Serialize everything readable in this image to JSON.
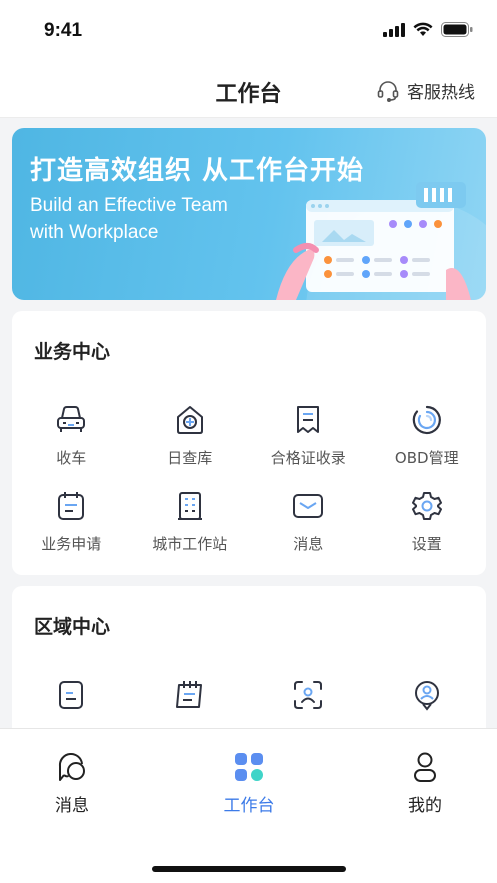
{
  "status_bar": {
    "time": "9:41"
  },
  "nav": {
    "title": "工作台",
    "service_label": "客服热线"
  },
  "banner": {
    "title": "打造高效组织 从工作台开始",
    "subtitle_line1": "Build an Effective Team",
    "subtitle_line2": "with Workplace"
  },
  "business_center": {
    "title": "业务中心",
    "items": [
      {
        "label": "收车",
        "icon": "car-icon"
      },
      {
        "label": "日查库",
        "icon": "warehouse-icon"
      },
      {
        "label": "合格证收录",
        "icon": "certificate-icon"
      },
      {
        "label": "OBD管理",
        "icon": "obd-gauge-icon"
      },
      {
        "label": "业务申请",
        "icon": "calendar-apply-icon"
      },
      {
        "label": "城市工作站",
        "icon": "building-icon"
      },
      {
        "label": "消息",
        "icon": "envelope-icon"
      },
      {
        "label": "设置",
        "icon": "gear-icon"
      }
    ]
  },
  "region_center": {
    "title": "区域中心",
    "items": [
      {
        "label": "",
        "icon": "document-icon"
      },
      {
        "label": "",
        "icon": "notebook-icon"
      },
      {
        "label": "",
        "icon": "face-scan-icon"
      },
      {
        "label": "",
        "icon": "location-user-icon"
      }
    ]
  },
  "tab_bar": {
    "tabs": [
      {
        "label": "消息",
        "icon": "chat-icon"
      },
      {
        "label": "工作台",
        "icon": "grid-icon"
      },
      {
        "label": "我的",
        "icon": "user-icon"
      }
    ],
    "accent": "#3d7be8"
  },
  "colors": {
    "banner": "#5bbde9",
    "accent": "#3d7be8",
    "background": "#f3f4f6"
  }
}
